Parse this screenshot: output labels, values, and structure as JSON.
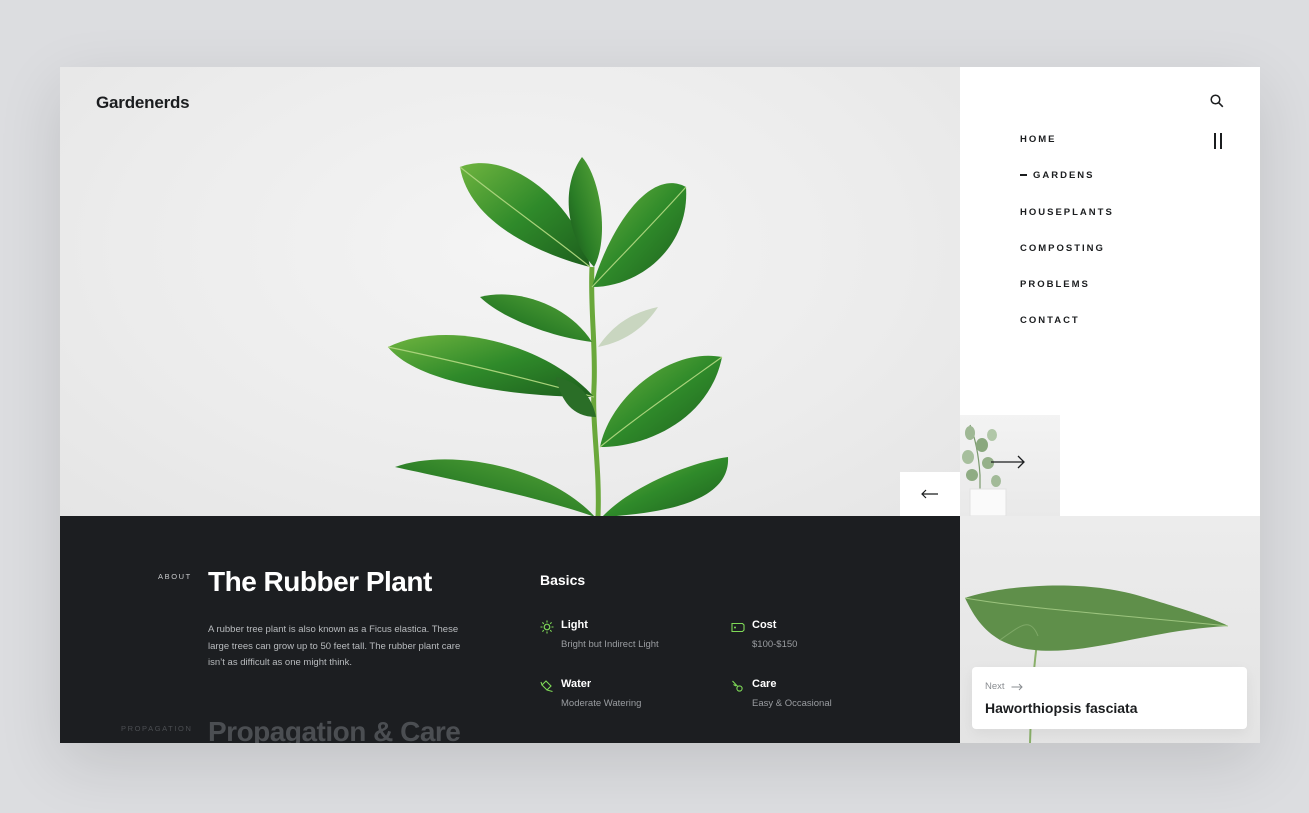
{
  "brand": {
    "logo": "Gardenerds"
  },
  "nav": {
    "items": [
      {
        "label": "HOME",
        "active": false
      },
      {
        "label": "GARDENS",
        "active": true
      },
      {
        "label": "HOUSEPLANTS",
        "active": false
      },
      {
        "label": "COMPOSTING",
        "active": false
      },
      {
        "label": "PROBLEMS",
        "active": false
      },
      {
        "label": "CONTACT",
        "active": false
      }
    ]
  },
  "about": {
    "label": "ABOUT",
    "title": "The Rubber Plant",
    "description": "A rubber tree plant is also known as a Ficus elastica. These large trees can grow up to 50 feet tall. The rubber plant care isn’t as difficult as one might think."
  },
  "basics": {
    "heading": "Basics",
    "items": [
      {
        "label": "Light",
        "value": "Bright but Indirect Light",
        "icon": "sun-icon"
      },
      {
        "label": "Cost",
        "value": "$100-$150",
        "icon": "price-tag-icon"
      },
      {
        "label": "Water",
        "value": "Moderate Watering",
        "icon": "watering-can-icon"
      },
      {
        "label": "Care",
        "value": "Easy & Occasional",
        "icon": "pruning-shears-icon"
      }
    ]
  },
  "propagation": {
    "label": "PROPAGATION",
    "title": "Propagation & Care"
  },
  "next": {
    "label": "Next",
    "name": "Haworthiopsis fasciata"
  },
  "colors": {
    "accent": "#7ed957",
    "dark": "#1c1e21",
    "background": "#dcdde0"
  }
}
